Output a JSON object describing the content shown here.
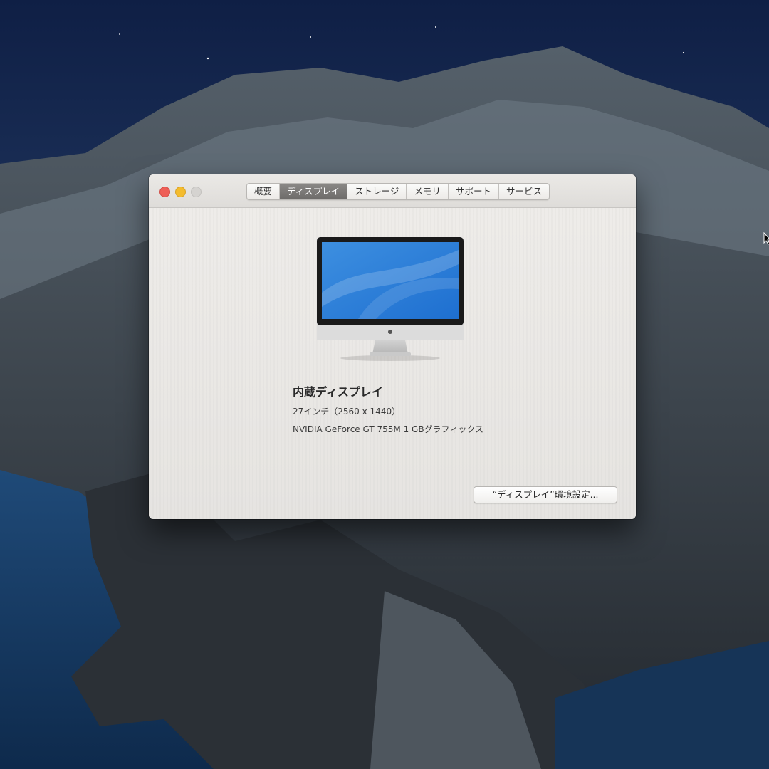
{
  "window": {
    "tabs": [
      {
        "label": "概要"
      },
      {
        "label": "ディスプレイ"
      },
      {
        "label": "ストレージ"
      },
      {
        "label": "メモリ"
      },
      {
        "label": "サポート"
      },
      {
        "label": "サービス"
      }
    ],
    "active_tab_index": 1,
    "traffic_lights": {
      "close": "#ee5f57",
      "minimize": "#f4bc2e",
      "zoom": "#d5d3d0"
    }
  },
  "display": {
    "icon": "imac-icon",
    "name": "内蔵ディスプレイ",
    "size": "27インチ（2560 x 1440）",
    "gpu": "NVIDIA GeForce GT 755M 1 GBグラフィックス"
  },
  "actions": {
    "display_prefs_label": "“ディスプレイ”環境設定..."
  },
  "colors": {
    "active_tab": "#7a7876",
    "window_bg": "#ebe9e6"
  }
}
